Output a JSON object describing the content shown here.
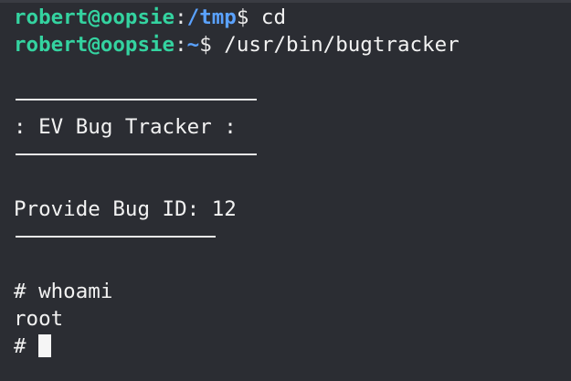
{
  "prompt1": {
    "user_host": "robert@oopsie",
    "separator": ":",
    "path": "/tmp",
    "symbol": "$",
    "command": " cd"
  },
  "prompt2": {
    "user_host": "robert@oopsie",
    "separator": ":",
    "path": "~",
    "symbol": "$",
    "command": " /usr/bin/bugtracker"
  },
  "banner_title": ": EV Bug Tracker :",
  "bug_prompt": "Provide Bug ID: 12",
  "root_prompt": {
    "command_line": "# whoami",
    "output": "root",
    "current_prompt": "# "
  },
  "colors": {
    "background": "#2b2d33",
    "user": "#34d3a0",
    "path": "#5aa2ff",
    "text": "#f2f2f2"
  }
}
